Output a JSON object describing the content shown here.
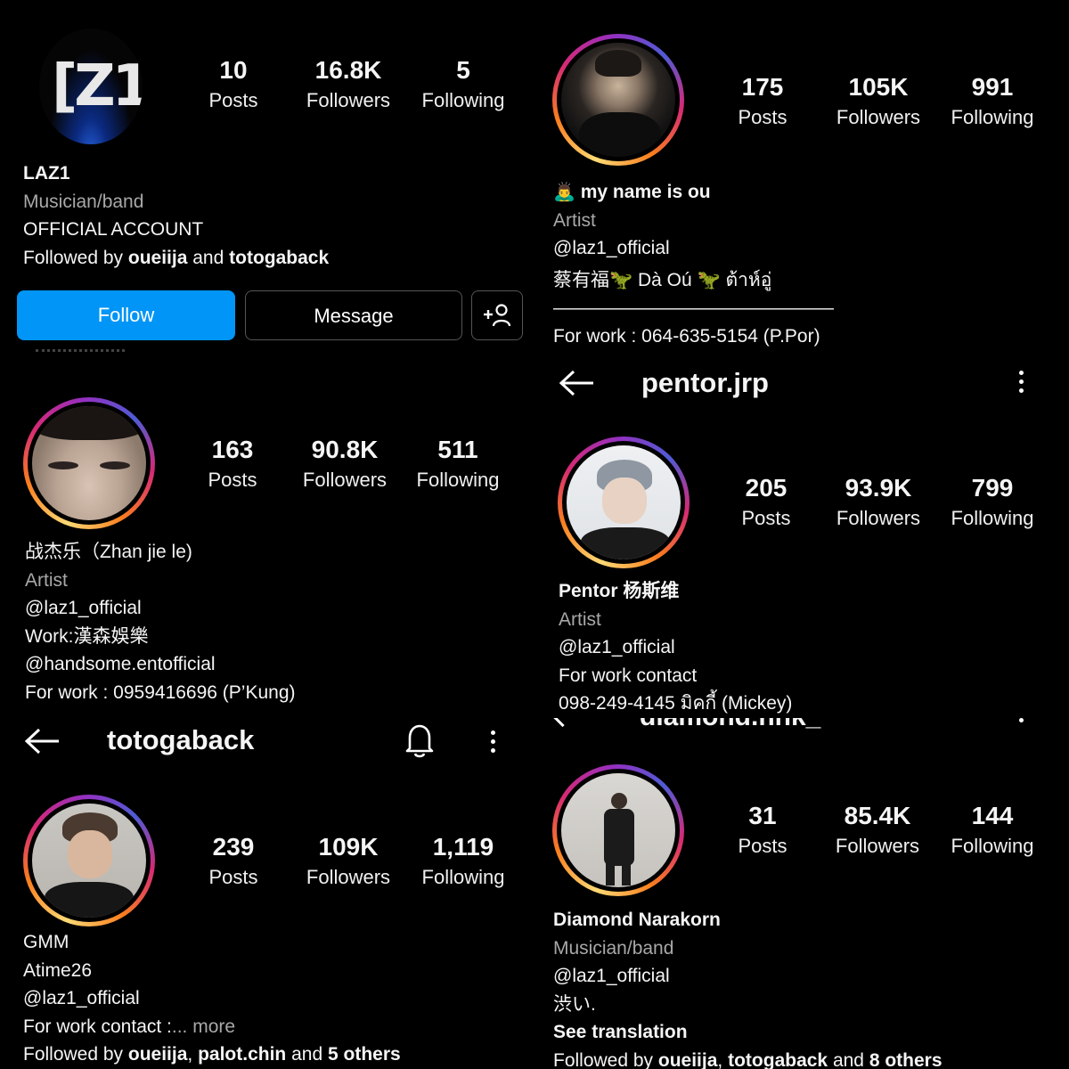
{
  "laz1": {
    "stats": [
      {
        "num": "10",
        "label": "Posts"
      },
      {
        "num": "16.8K",
        "label": "Followers"
      },
      {
        "num": "5",
        "label": "Following"
      }
    ],
    "name": "LAZ1",
    "category": "Musician/band",
    "bio": "OFFICIAL ACCOUNT",
    "followed_prefix": "Followed by ",
    "followed_user1": "oueiija",
    "followed_and": " and ",
    "followed_user2": "totogaback",
    "follow_label": "Follow",
    "message_label": "Message",
    "logo_text": "[Z1"
  },
  "ou": {
    "stats": [
      {
        "num": "175",
        "label": "Posts"
      },
      {
        "num": "105K",
        "label": "Followers"
      },
      {
        "num": "991",
        "label": "Following"
      }
    ],
    "name": "my name is ou",
    "category": "Artist",
    "mention": "@laz1_official",
    "bio_line": "蔡有福🦖 Dà Oú 🦖 ต้าห์อู่",
    "divider": "———————————————",
    "work": "For work : 064-635-5154 (P.Por)"
  },
  "zhan": {
    "stats": [
      {
        "num": "163",
        "label": "Posts"
      },
      {
        "num": "90.8K",
        "label": "Followers"
      },
      {
        "num": "511",
        "label": "Following"
      }
    ],
    "name": "战杰乐（Zhan jie le)",
    "category": "Artist",
    "mention": "@laz1_official",
    "work_line": "Work:漢森娛樂",
    "mention2": "@handsome.entofficial",
    "work": "For work : 0959416696  (P’Kung)"
  },
  "pentor": {
    "username": "pentor.jrp",
    "stats": [
      {
        "num": "205",
        "label": "Posts"
      },
      {
        "num": "93.9K",
        "label": "Followers"
      },
      {
        "num": "799",
        "label": "Following"
      }
    ],
    "name": "Pentor 杨斯维",
    "category": "Artist",
    "mention": "@laz1_official",
    "work_label": "For work contact",
    "work_phone": "098-249-4145 มิคกี้ (Mickey)"
  },
  "toto": {
    "username": "totogaback",
    "stats": [
      {
        "num": "239",
        "label": "Posts"
      },
      {
        "num": "109K",
        "label": "Followers"
      },
      {
        "num": "1,119",
        "label": "Following"
      }
    ],
    "line1": "GMM",
    "line2": "Atime26",
    "mention": "@laz1_official",
    "work": "For work contact :",
    "more": "... more",
    "followed_prefix": "Followed by ",
    "followed_user1": "oueiija",
    "followed_sep": ", ",
    "followed_user2": "palot.chin",
    "followed_and": " and ",
    "followed_others": "5 others"
  },
  "diamond": {
    "username_partial": "diamond.nnk_",
    "stats": [
      {
        "num": "31",
        "label": "Posts"
      },
      {
        "num": "85.4K",
        "label": "Followers"
      },
      {
        "num": "144",
        "label": "Following"
      }
    ],
    "name": "Diamond Narakorn",
    "category": "Musician/band",
    "mention": "@laz1_official",
    "bio": "渋い.",
    "translation": "See translation",
    "followed_prefix": "Followed by ",
    "followed_user1": "oueiija",
    "followed_sep": ", ",
    "followed_user2": "totogaback",
    "followed_and": " and ",
    "followed_others": "8 others"
  },
  "colors": {
    "accent": "#0095f6",
    "muted": "#a8a8a8",
    "button_dark": "#000000"
  }
}
